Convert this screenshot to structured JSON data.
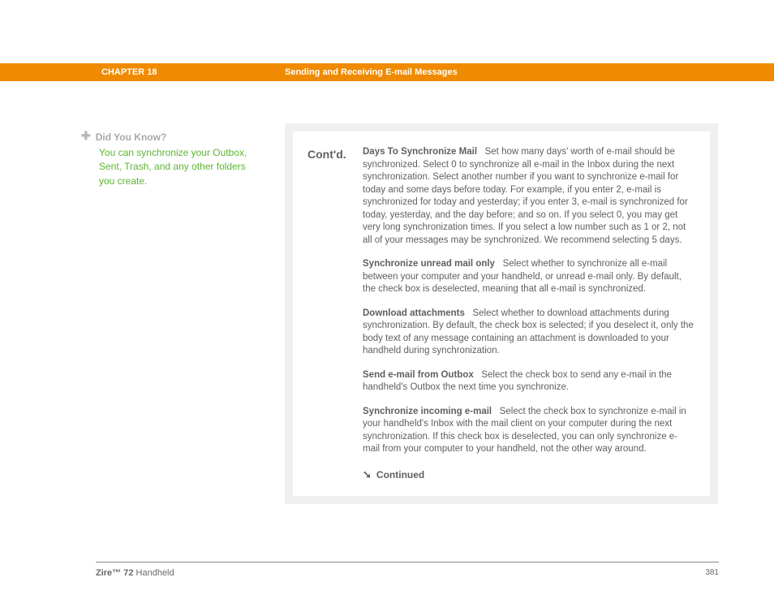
{
  "header": {
    "chapter": "CHAPTER 18",
    "title": "Sending and Receiving E-mail Messages"
  },
  "sidebar": {
    "dyk_title": "Did You Know?",
    "dyk_body": "You can synchronize your Outbox, Sent, Trash, and any other folders you create."
  },
  "content": {
    "contd": "Cont'd.",
    "paras": [
      {
        "title": "Days To Synchronize Mail",
        "body": "Set how many days' worth of e-mail should be synchronized. Select 0 to synchronize all e-mail in the Inbox during the next synchronization. Select another number if you want to synchronize e-mail for today and some days before today. For example, if you enter 2, e-mail is synchronized for today and yesterday; if you enter 3, e-mail is synchronized for today, yesterday, and the day before; and so on. If you select 0, you may get very long synchronization times. If you select a low number such as 1 or 2, not all of your messages may be synchronized. We recommend selecting 5 days."
      },
      {
        "title": "Synchronize unread mail only",
        "body": "Select whether to synchronize all e-mail between your computer and your handheld, or unread e-mail only. By default, the check box is deselected, meaning that all e-mail is synchronized."
      },
      {
        "title": "Download attachments",
        "body": "Select whether to download attachments during synchronization. By default, the check box is selected; if you deselect it, only the body text of any message containing an attachment is downloaded to your handheld during synchronization."
      },
      {
        "title": "Send e-mail from Outbox",
        "body": "Select the check box to send any e-mail in the handheld's Outbox the next time you synchronize."
      },
      {
        "title": "Synchronize incoming e-mail",
        "body": "Select the check box to synchronize e-mail in your handheld's Inbox with the mail client on your computer during the next synchronization. If this check box is deselected, you can only synchronize e-mail from your computer to your handheld, not the other way around."
      }
    ],
    "continued": "Continued"
  },
  "footer": {
    "product_bold": "Zire™ 72",
    "product_rest": " Handheld",
    "page": "381"
  }
}
